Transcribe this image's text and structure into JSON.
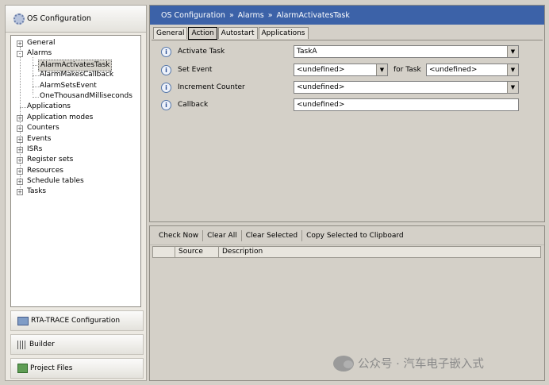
{
  "left_panel": {
    "header": "OS Configuration",
    "tree": [
      {
        "label": "General",
        "level": 0,
        "expander": "+"
      },
      {
        "label": "Alarms",
        "level": 0,
        "expander": "-"
      },
      {
        "label": "AlarmActivatesTask",
        "level": 1,
        "selected": true
      },
      {
        "label": "AlarmMakesCallback",
        "level": 1
      },
      {
        "label": "AlarmSetsEvent",
        "level": 1
      },
      {
        "label": "OneThousandMilliseconds",
        "level": 1
      },
      {
        "label": "Applications",
        "level": 0
      },
      {
        "label": "Application modes",
        "level": 0,
        "expander": "+"
      },
      {
        "label": "Counters",
        "level": 0,
        "expander": "+"
      },
      {
        "label": "Events",
        "level": 0,
        "expander": "+"
      },
      {
        "label": "ISRs",
        "level": 0,
        "expander": "+"
      },
      {
        "label": "Register sets",
        "level": 0,
        "expander": "+"
      },
      {
        "label": "Resources",
        "level": 0,
        "expander": "+"
      },
      {
        "label": "Schedule tables",
        "level": 0,
        "expander": "+"
      },
      {
        "label": "Tasks",
        "level": 0,
        "expander": "+"
      }
    ],
    "nav": {
      "rta": "RTA-TRACE Configuration",
      "builder": "Builder",
      "files": "Project Files"
    },
    "icons": {
      "header": "gear-icon",
      "rta": "rta-trace-icon",
      "builder": "builder-icon",
      "files": "project-files-icon"
    }
  },
  "breadcrumb": {
    "items": [
      "OS Configuration",
      "Alarms",
      "AlarmActivatesTask"
    ],
    "separator": "»"
  },
  "tabs": {
    "items": [
      {
        "label": "General"
      },
      {
        "label": "Action",
        "active": true
      },
      {
        "label": "Autostart"
      },
      {
        "label": "Applications"
      }
    ]
  },
  "form": {
    "activate_task": {
      "label": "Activate Task",
      "value": "TaskA"
    },
    "set_event": {
      "label": "Set Event",
      "value": "<undefined>",
      "for_task_label": "for Task",
      "for_task_value": "<undefined>"
    },
    "increment_counter": {
      "label": "Increment Counter",
      "value": "<undefined>"
    },
    "callback": {
      "label": "Callback",
      "value": "<undefined>"
    },
    "info_glyph": "i"
  },
  "messages": {
    "toolbar": {
      "check_now": "Check Now",
      "clear_all": "Clear All",
      "clear_selected": "Clear Selected",
      "copy": "Copy Selected to Clipboard"
    },
    "columns": [
      "",
      "Source",
      "Description"
    ]
  },
  "watermark": {
    "text": "公众号 · 汽车电子嵌入式"
  },
  "colors": {
    "title_bar": "#3c62a8",
    "panel": "#d4d0c8"
  }
}
